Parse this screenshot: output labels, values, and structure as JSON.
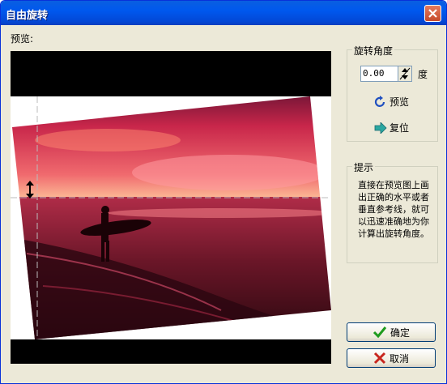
{
  "window": {
    "title": "自由旋转"
  },
  "preview": {
    "label": "预览:"
  },
  "rotation": {
    "group_title": "旋转角度",
    "angle_value": "0.00",
    "unit": "度",
    "preview_button": "预览",
    "reset_button": "复位"
  },
  "hint": {
    "group_title": "提示",
    "text": "直接在预览图上画出正确的水平或者垂直参考线，就可以迅速准确地为你计算出旋转角度。"
  },
  "buttons": {
    "ok": "确定",
    "cancel": "取消"
  },
  "colors": {
    "title_bar": "#0058ee",
    "ok_check": "#1e9b1e",
    "cancel_x": "#c8261e",
    "link_icon": "#1f4fbf"
  }
}
